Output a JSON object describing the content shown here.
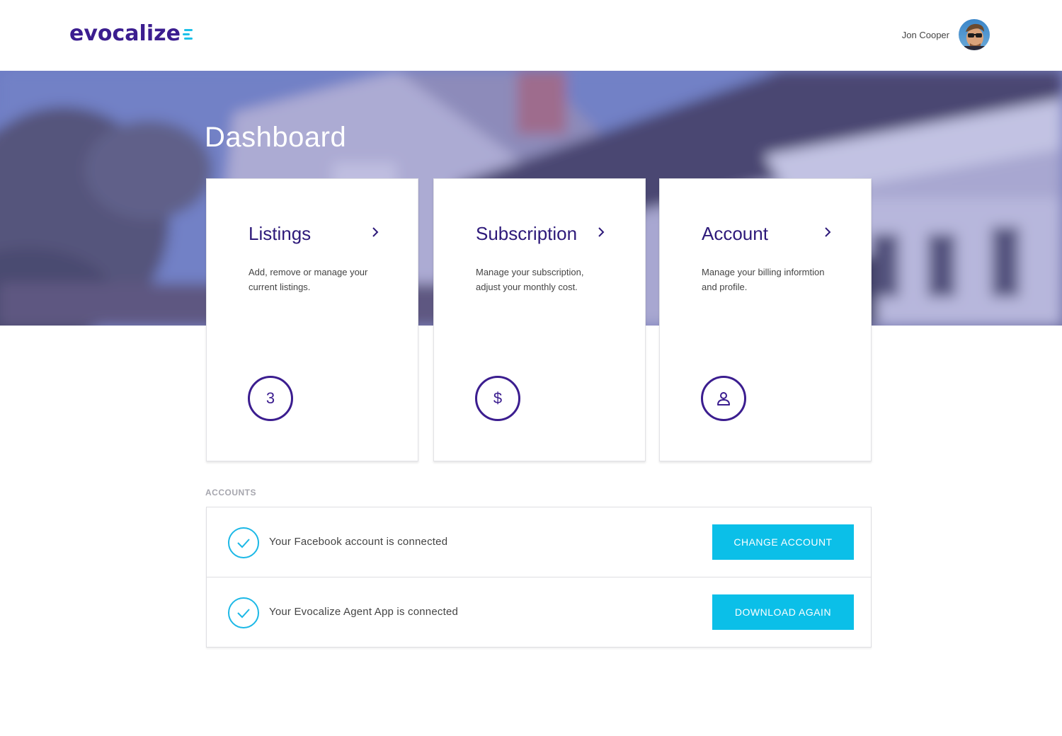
{
  "header": {
    "logo_text": "evocalize",
    "user_name": "Jon Cooper"
  },
  "hero": {
    "title": "Dashboard"
  },
  "cards": [
    {
      "title": "Listings",
      "description": "Add, remove or manage your current listings.",
      "badge": "3",
      "icon": "number-badge"
    },
    {
      "title": "Subscription",
      "description": "Manage your subscription, adjust your monthly cost.",
      "badge": "$",
      "icon": "dollar-icon"
    },
    {
      "title": "Account",
      "description": "Manage your billing informtion and profile.",
      "badge": "",
      "icon": "user-icon"
    }
  ],
  "accounts": {
    "label": "ACCOUNTS",
    "rows": [
      {
        "text": "Your Facebook account is connected",
        "button": "CHANGE ACCOUNT",
        "icon": "check-circle-icon"
      },
      {
        "text": "Your Evocalize Agent App is connected",
        "button": "DOWNLOAD AGAIN",
        "icon": "check-circle-icon"
      }
    ]
  },
  "colors": {
    "brand_purple": "#3b1d8f",
    "accent_cyan": "#0bbfe8"
  }
}
